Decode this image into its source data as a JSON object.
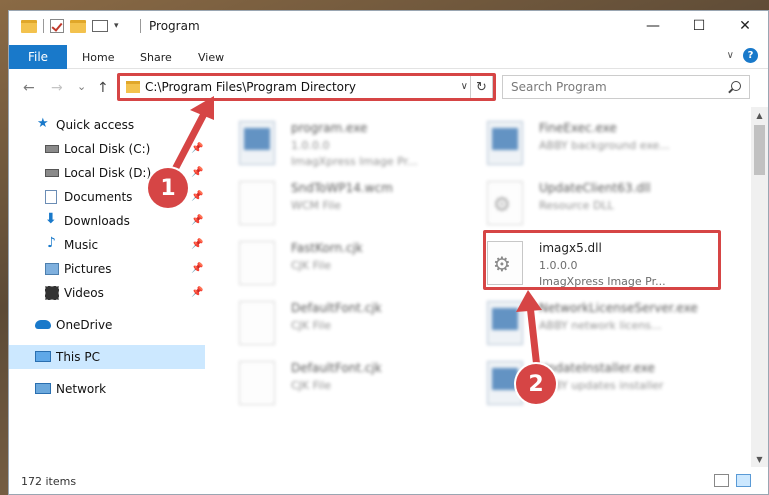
{
  "window": {
    "title": "Program",
    "controls": {
      "minimize": "—",
      "maximize": "☐",
      "close": "✕"
    }
  },
  "ribbon": {
    "tabs": [
      "File",
      "Home",
      "Share",
      "View"
    ]
  },
  "nav": {
    "back": "←",
    "forward": "→",
    "recent": "⌄",
    "up": "↑",
    "address": "C:\\Program Files\\Program Directory",
    "search_placeholder": "Search Program"
  },
  "sidebar": {
    "items": [
      {
        "label": "Quick access",
        "icon": "star-icon",
        "pinned": false
      },
      {
        "label": "Local Disk (C:)",
        "icon": "drive-icon",
        "pinned": true
      },
      {
        "label": "Local Disk (D:)",
        "icon": "drive-icon",
        "pinned": true
      },
      {
        "label": "Documents",
        "icon": "documents-icon",
        "pinned": true
      },
      {
        "label": "Downloads",
        "icon": "download-icon",
        "pinned": true
      },
      {
        "label": "Music",
        "icon": "music-icon",
        "pinned": true
      },
      {
        "label": "Pictures",
        "icon": "pictures-icon",
        "pinned": true
      },
      {
        "label": "Videos",
        "icon": "videos-icon",
        "pinned": true
      },
      {
        "label": "OneDrive",
        "icon": "cloud-icon",
        "pinned": false
      },
      {
        "label": "This PC",
        "icon": "computer-icon",
        "pinned": false,
        "selected": true
      },
      {
        "label": "Network",
        "icon": "network-icon",
        "pinned": false
      }
    ]
  },
  "files": [
    {
      "name": "program.exe",
      "line2": "1.0.0.0",
      "line3": "ImagXpress Image Pr...",
      "icon": "installer-icon"
    },
    {
      "name": "FineExec.exe",
      "line2": "ABBY background exe...",
      "line3": "",
      "icon": "exe-icon"
    },
    {
      "name": "SndToWP14.wcm",
      "line2": "WCM File",
      "line3": "",
      "icon": "file-icon"
    },
    {
      "name": "UpdateClient63.dll",
      "line2": "Resource DLL",
      "line3": "",
      "icon": "dll-icon"
    },
    {
      "name": "FastKorn.cjk",
      "line2": "CJK File",
      "line3": "",
      "icon": "file-icon"
    },
    {
      "name": "imagx5.dll",
      "line2": "1.0.0.0",
      "line3": "ImagXpress Image Pr...",
      "icon": "dll-icon"
    },
    {
      "name": "DefaultFont.cjk",
      "line2": "CJK File",
      "line3": "",
      "icon": "file-icon"
    },
    {
      "name": "NetworkLicenseServer.exe",
      "line2": "ABBY network licens...",
      "line3": "",
      "icon": "exe-icon"
    },
    {
      "name": "DefaultFont.cjk",
      "line2": "CJK File",
      "line3": "",
      "icon": "file-icon"
    },
    {
      "name": "UpdateInstaller.exe",
      "line2": "ABBY updates installer",
      "line3": "",
      "icon": "exe-icon"
    }
  ],
  "status": {
    "item_count": "172 items"
  },
  "annotations": {
    "step1": "1",
    "step2": "2",
    "color": "#d64545"
  },
  "colors": {
    "accent": "#1979ca",
    "selection": "#cce8ff"
  }
}
